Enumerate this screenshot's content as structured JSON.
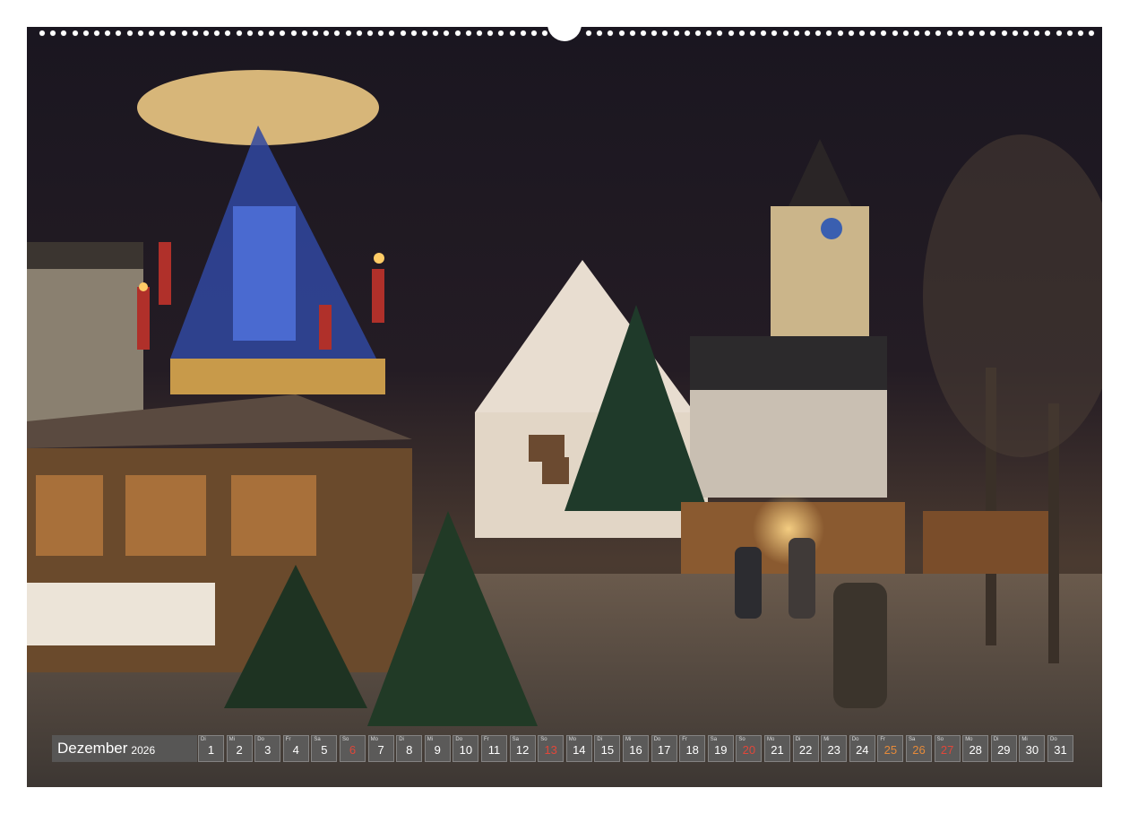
{
  "calendar": {
    "month": "Dezember",
    "year": "2026",
    "days": [
      {
        "wd": "Di",
        "num": "1",
        "type": "normal"
      },
      {
        "wd": "Mi",
        "num": "2",
        "type": "normal"
      },
      {
        "wd": "Do",
        "num": "3",
        "type": "normal"
      },
      {
        "wd": "Fr",
        "num": "4",
        "type": "normal"
      },
      {
        "wd": "Sa",
        "num": "5",
        "type": "normal"
      },
      {
        "wd": "So",
        "num": "6",
        "type": "sun"
      },
      {
        "wd": "Mo",
        "num": "7",
        "type": "normal"
      },
      {
        "wd": "Di",
        "num": "8",
        "type": "normal"
      },
      {
        "wd": "Mi",
        "num": "9",
        "type": "normal"
      },
      {
        "wd": "Do",
        "num": "10",
        "type": "normal"
      },
      {
        "wd": "Fr",
        "num": "11",
        "type": "normal"
      },
      {
        "wd": "Sa",
        "num": "12",
        "type": "normal"
      },
      {
        "wd": "So",
        "num": "13",
        "type": "sun"
      },
      {
        "wd": "Mo",
        "num": "14",
        "type": "normal"
      },
      {
        "wd": "Di",
        "num": "15",
        "type": "normal"
      },
      {
        "wd": "Mi",
        "num": "16",
        "type": "normal"
      },
      {
        "wd": "Do",
        "num": "17",
        "type": "normal"
      },
      {
        "wd": "Fr",
        "num": "18",
        "type": "normal"
      },
      {
        "wd": "Sa",
        "num": "19",
        "type": "normal"
      },
      {
        "wd": "So",
        "num": "20",
        "type": "sun"
      },
      {
        "wd": "Mo",
        "num": "21",
        "type": "normal"
      },
      {
        "wd": "Di",
        "num": "22",
        "type": "normal"
      },
      {
        "wd": "Mi",
        "num": "23",
        "type": "normal"
      },
      {
        "wd": "Do",
        "num": "24",
        "type": "normal"
      },
      {
        "wd": "Fr",
        "num": "25",
        "type": "hol2"
      },
      {
        "wd": "Sa",
        "num": "26",
        "type": "hol2"
      },
      {
        "wd": "So",
        "num": "27",
        "type": "sun"
      },
      {
        "wd": "Mo",
        "num": "28",
        "type": "normal"
      },
      {
        "wd": "Di",
        "num": "29",
        "type": "normal"
      },
      {
        "wd": "Mi",
        "num": "30",
        "type": "normal"
      },
      {
        "wd": "Do",
        "num": "31",
        "type": "normal"
      }
    ]
  },
  "colors": {
    "sunday": "#e0473a",
    "holiday": "#e58a3a",
    "bar": "#5f5f5f"
  }
}
